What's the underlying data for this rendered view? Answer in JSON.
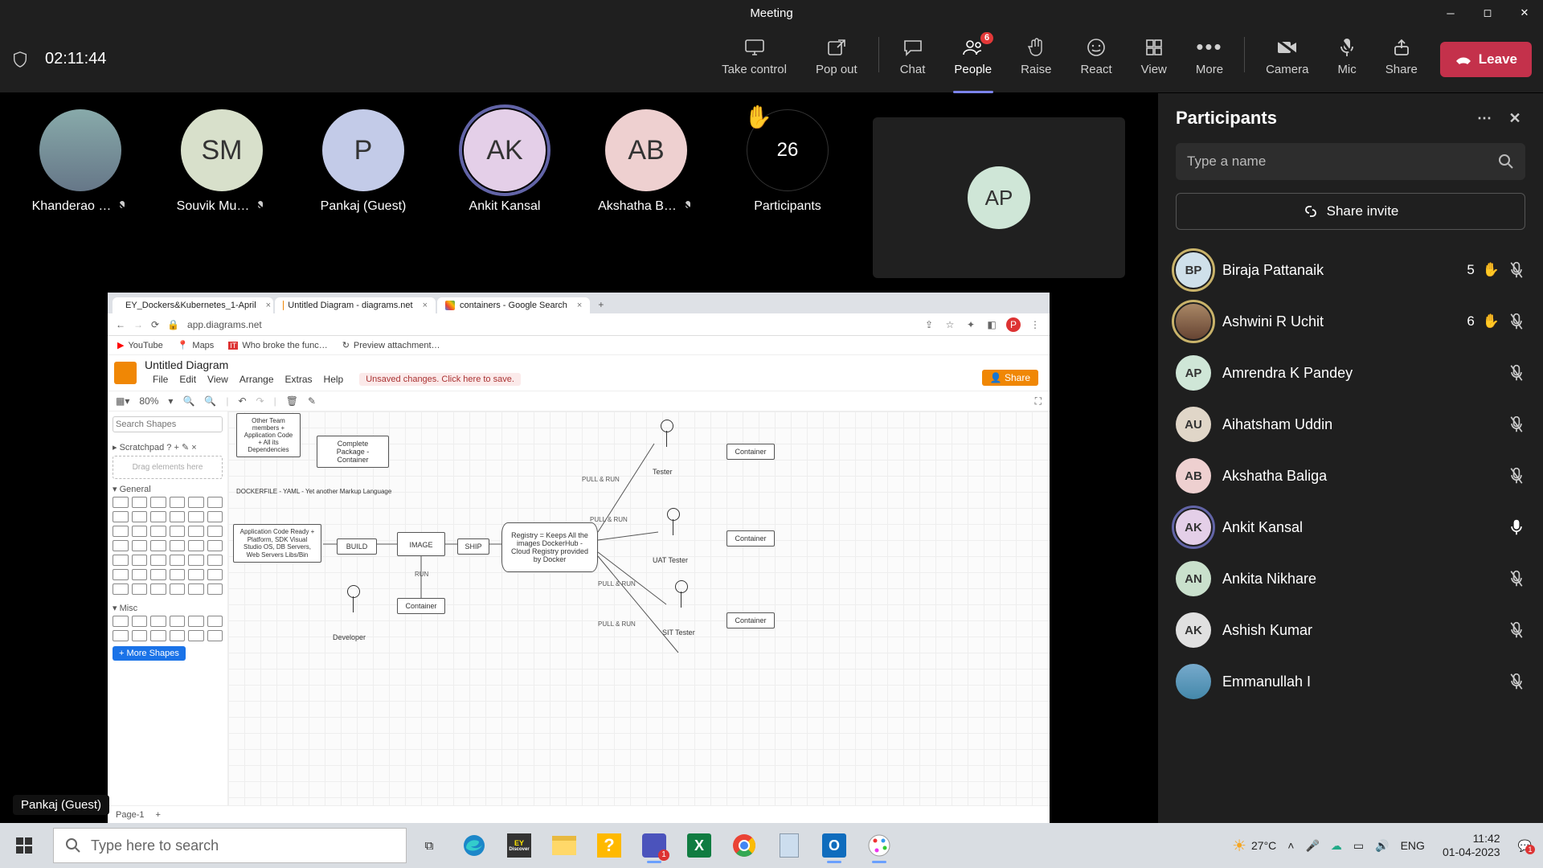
{
  "window": {
    "title": "Meeting"
  },
  "timer": "02:11:44",
  "toolbar": {
    "take_control": "Take control",
    "pop_out": "Pop out",
    "chat": "Chat",
    "people": "People",
    "people_badge": "6",
    "raise": "Raise",
    "react": "React",
    "view": "View",
    "more": "More",
    "camera": "Camera",
    "mic": "Mic",
    "share": "Share",
    "leave": "Leave"
  },
  "strip": {
    "p1": {
      "name": "Khanderao …",
      "muted": true,
      "color": "#9bb0c8"
    },
    "p2": {
      "name": "Souvik Mu…",
      "initials": "SM",
      "muted": true,
      "color": "#d8e0cb"
    },
    "p3": {
      "name": "Pankaj (Guest)",
      "initials": "P",
      "muted": false,
      "color": "#c3cbe8"
    },
    "p4": {
      "name": "Ankit Kansal",
      "initials": "AK",
      "muted": false,
      "color": "#e4cfe8",
      "speaking": true
    },
    "p5": {
      "name": "Akshatha B…",
      "initials": "AB",
      "muted": true,
      "color": "#eed0d0"
    },
    "overflow_count": "26",
    "overflow_label": "Participants",
    "tile_initials": "AP",
    "tile_color": "#cfe6d7"
  },
  "shared": {
    "presenter": "Pankaj (Guest)",
    "tabs": {
      "t1": "EY_Dockers&Kubernetes_1-April",
      "t2": "Untitled Diagram - diagrams.net",
      "t3": "containers - Google Search"
    },
    "url": "app.diagrams.net",
    "bookmarks": {
      "b1": "YouTube",
      "b2": "Maps",
      "b3": "Who broke the func…",
      "b4": "Preview attachment…"
    },
    "diag": {
      "title": "Untitled Diagram",
      "menu": {
        "file": "File",
        "edit": "Edit",
        "view": "View",
        "arrange": "Arrange",
        "extras": "Extras",
        "help": "Help"
      },
      "warn": "Unsaved changes. Click here to save.",
      "share": "Share",
      "zoom": "80%",
      "search_ph": "Search Shapes",
      "scratch_label": "Scratchpad",
      "scratch_hint": "Drag elements here",
      "general": "General",
      "misc": "Misc",
      "more_shapes": "+ More Shapes",
      "page": "Page-1",
      "nodes": {
        "pkg": "Complete Package - Container",
        "ready": "Application Code Ready + Platform, SDK Visual Studio OS, DB Servers, Web Servers Libs/Bin",
        "build": "BUILD",
        "image": "IMAGE",
        "ship": "SHIP",
        "registry": "Registry = Keeps All the images\nDockerHub - Cloud Registry provided by Docker",
        "container": "Container",
        "tester": "Tester",
        "uat": "UAT Tester",
        "sit": "SIT Tester",
        "dev": "Developer",
        "pull": "PULL & RUN",
        "run": "RUN",
        "dockerfile": "DOCKERFILE - YAML - Yet another Markup Language",
        "deps": "Other Team members + Application Code + All its Dependencies"
      }
    }
  },
  "panel": {
    "title": "Participants",
    "search_ph": "Type a name",
    "share_invite": "Share invite",
    "rows": {
      "r1": {
        "initials": "BP",
        "name": "Biraja Pattanaik",
        "num": "5",
        "hand": true,
        "muted": true,
        "color": "#cfe0ea",
        "speaking": true
      },
      "r2": {
        "initials": "",
        "name": "Ashwini R Uchit",
        "num": "6",
        "hand": true,
        "muted": true,
        "color": "#caa",
        "speaking": true,
        "photo": true
      },
      "r3": {
        "initials": "AP",
        "name": "Amrendra K Pandey",
        "muted": true,
        "color": "#cfe6d7"
      },
      "r4": {
        "initials": "AU",
        "name": "Aihatsham Uddin",
        "muted": true,
        "color": "#e0d6c8"
      },
      "r5": {
        "initials": "AB",
        "name": "Akshatha Baliga",
        "muted": true,
        "color": "#eed0d0"
      },
      "r6": {
        "initials": "AK",
        "name": "Ankit Kansal",
        "muted": false,
        "color": "#e4cfe8",
        "speaking": true
      },
      "r7": {
        "initials": "AN",
        "name": "Ankita Nikhare",
        "muted": true,
        "color": "#c9e0cc"
      },
      "r8": {
        "initials": "AK",
        "name": "Ashish Kumar",
        "muted": true,
        "color": "#e0e0e0"
      },
      "r9": {
        "initials": "",
        "name": "Emmanullah I",
        "muted": true,
        "color": "#88b0d0",
        "photo": true
      }
    }
  },
  "taskbar": {
    "search_ph": "Type here to search",
    "weather": "27°C",
    "lang": "ENG",
    "time": "11:42",
    "date": "01-04-2023",
    "notif": "1"
  }
}
